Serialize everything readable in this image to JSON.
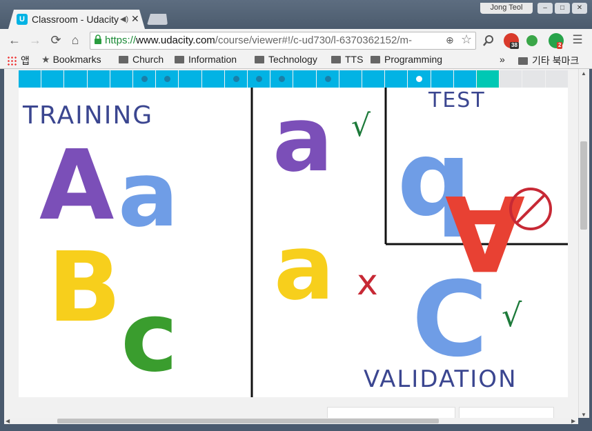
{
  "browser": {
    "tab_title": "Classroom - Udacity",
    "favicon_letter": "U",
    "audio_indicator": "◀)",
    "close_glyph": "✕",
    "profile_name": "Jong Teol",
    "window_buttons": [
      "–",
      "□",
      "✕"
    ],
    "url_scheme": "https://",
    "url_host": "www.udacity.com",
    "url_path": "/course/viewer#!/c-ud730/l-6370362152/m-",
    "extension_badges": [
      "38",
      "2"
    ],
    "bookmarks": {
      "apps_label": "앱",
      "items": [
        "Bookmarks",
        "Church",
        "Information",
        "Technology",
        "TTS",
        "Programming"
      ],
      "overflow": "»",
      "other_bookmarks": "기타 북마크"
    }
  },
  "progress": {
    "segment_count": 24,
    "dot_segments": [
      5,
      6,
      9,
      10,
      11,
      13,
      17
    ],
    "current_segment": 17,
    "colors": {
      "active": "#02b3e4",
      "accent": "#00c8b4",
      "inactive": "#e4e5e7"
    }
  },
  "video": {
    "labels": {
      "training": "TRAINING",
      "test": "TEST",
      "validation": "VALIDATION"
    },
    "letters": {
      "training_A": "A",
      "training_a": "a",
      "training_B": "B",
      "training_c": "c",
      "right_a_purple": "a",
      "right_a_yellow": "a",
      "test_b": "b",
      "test_A": "A",
      "valid_c": "C"
    },
    "marks": {
      "check": "√",
      "cross": "x"
    },
    "colors": {
      "purple": "#7b4fb8",
      "blue": "#6f9de6",
      "yellow": "#f7cf1c",
      "green": "#3a9d2e",
      "red": "#e84133",
      "ink": "#3b4690",
      "check_green": "#1d7a3a",
      "cross_red": "#c72935"
    }
  }
}
